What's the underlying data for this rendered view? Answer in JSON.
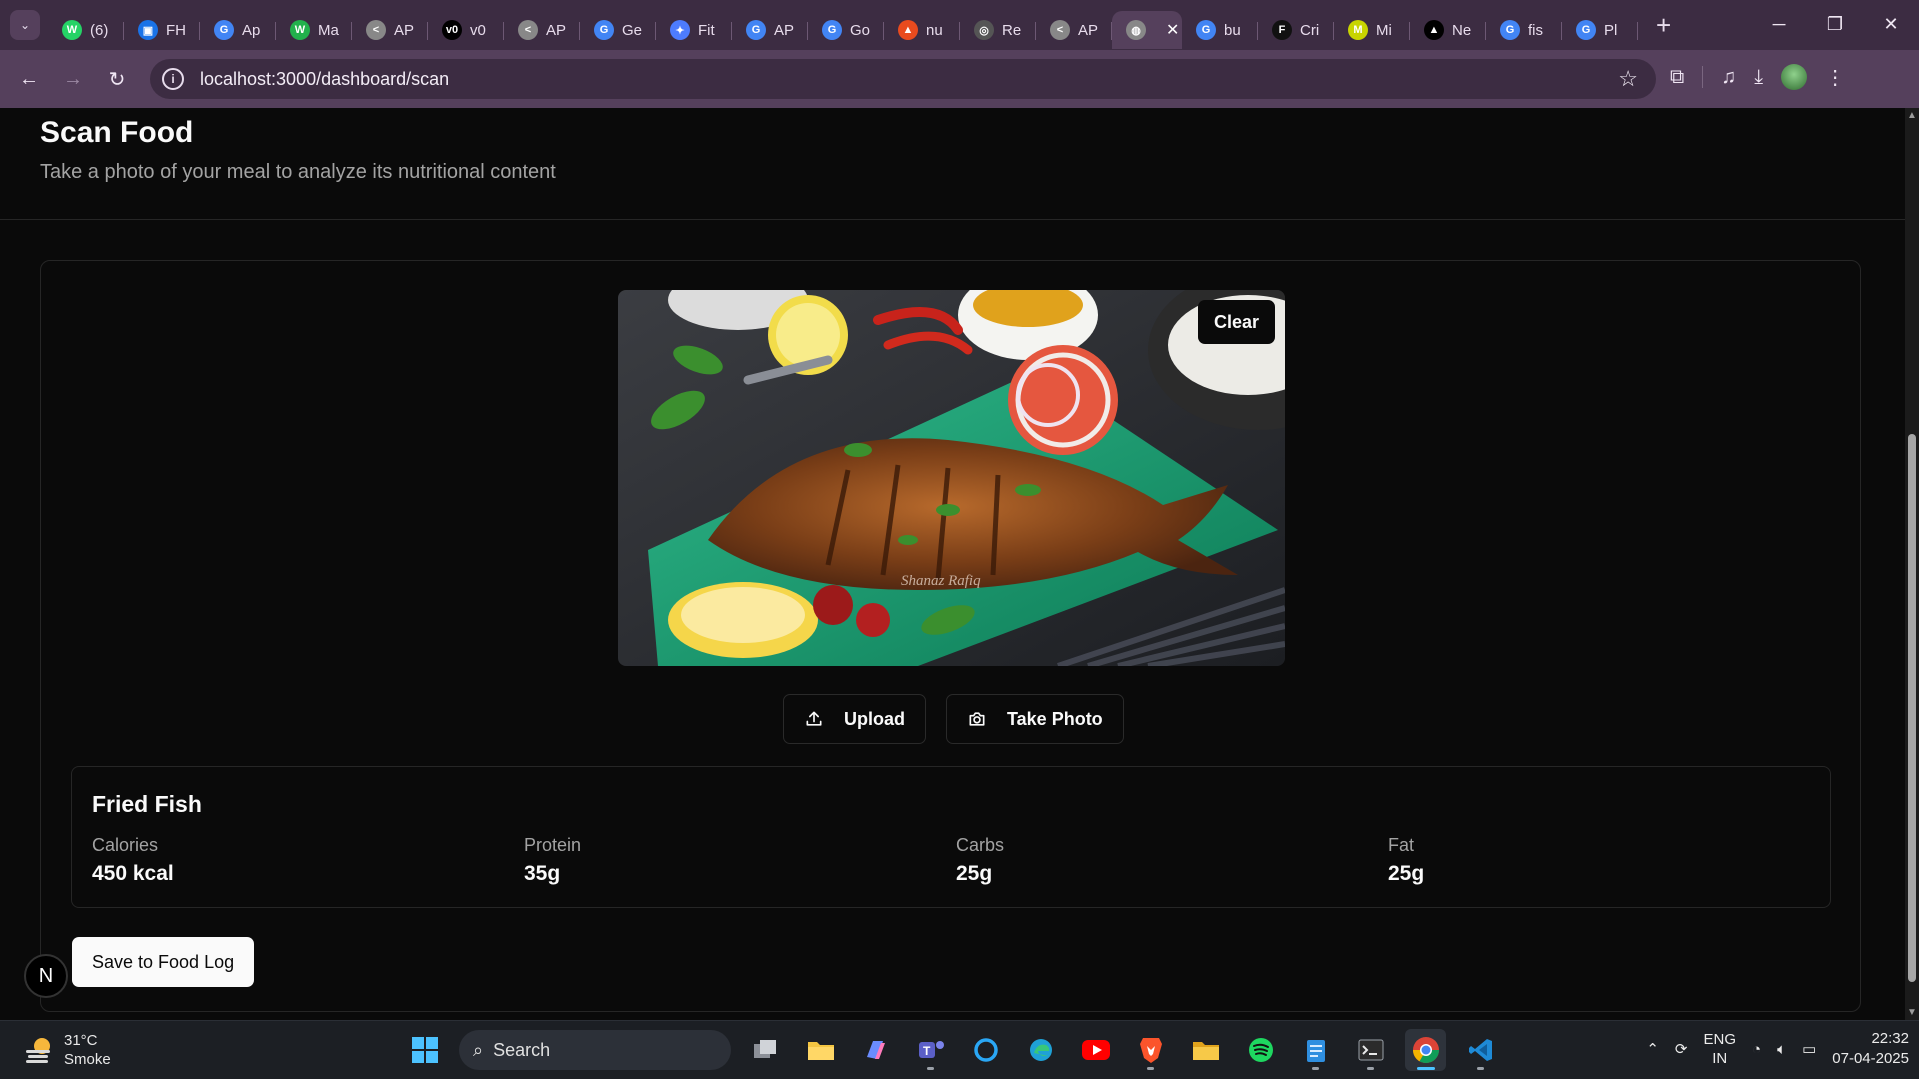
{
  "browser": {
    "tabs": [
      {
        "label": "(6)",
        "fav": "whatsapp-icon",
        "color": "#25d366",
        "glyph": "W"
      },
      {
        "label": "FH",
        "fav": "contact-icon",
        "color": "#1a73e8",
        "glyph": "▣"
      },
      {
        "label": "Ap",
        "fav": "google-icon",
        "color": "#4285f4",
        "glyph": "G"
      },
      {
        "label": "Ma",
        "fav": "w-icon",
        "color": "#22b14c",
        "glyph": "W"
      },
      {
        "label": "AP",
        "fav": "postman-icon",
        "color": "#888888",
        "glyph": "<"
      },
      {
        "label": "v0",
        "fav": "v0-icon",
        "color": "#000000",
        "glyph": "v0"
      },
      {
        "label": "AP",
        "fav": "postman-icon",
        "color": "#888888",
        "glyph": "<"
      },
      {
        "label": "Ge",
        "fav": "google-icon",
        "color": "#4285f4",
        "glyph": "G"
      },
      {
        "label": "Fit",
        "fav": "fit-icon",
        "color": "#4d7cfe",
        "glyph": "✦"
      },
      {
        "label": "AP",
        "fav": "google-icon",
        "color": "#4285f4",
        "glyph": "G"
      },
      {
        "label": "Go",
        "fav": "google-icon",
        "color": "#4285f4",
        "glyph": "G"
      },
      {
        "label": "nu",
        "fav": "flame-icon",
        "color": "#e94b1e",
        "glyph": "▲"
      },
      {
        "label": "Re",
        "fav": "openai-icon",
        "color": "#555555",
        "glyph": "◎"
      },
      {
        "label": "AP",
        "fav": "postman-icon",
        "color": "#888888",
        "glyph": "<"
      },
      {
        "label": "",
        "fav": "globe-icon",
        "color": "#888888",
        "glyph": "◍",
        "active": true
      },
      {
        "label": "bu",
        "fav": "google-icon",
        "color": "#4285f4",
        "glyph": "G"
      },
      {
        "label": "Cri",
        "fav": "fw-icon",
        "color": "#111111",
        "glyph": "F"
      },
      {
        "label": "Mi",
        "fav": "mi-icon",
        "color": "#c8d400",
        "glyph": "M"
      },
      {
        "label": "Ne",
        "fav": "vercel-icon",
        "color": "#000000",
        "glyph": "▲"
      },
      {
        "label": "fis",
        "fav": "google-icon",
        "color": "#4285f4",
        "glyph": "G"
      },
      {
        "label": "Pl",
        "fav": "google-icon",
        "color": "#4285f4",
        "glyph": "G"
      }
    ],
    "url": "localhost:3000/dashboard/scan"
  },
  "page": {
    "title": "Scan Food",
    "subtitle": "Take a photo of your meal to analyze its nutritional content",
    "clear_label": "Clear",
    "upload_label": "Upload",
    "take_photo_label": "Take Photo",
    "save_label": "Save to Food Log",
    "watermark": "Shanaz Rafiq",
    "result": {
      "food": "Fried Fish",
      "nutrients": [
        {
          "label": "Calories",
          "value": "450 kcal"
        },
        {
          "label": "Protein",
          "value": "35g"
        },
        {
          "label": "Carbs",
          "value": "25g"
        },
        {
          "label": "Fat",
          "value": "25g"
        }
      ]
    },
    "next_badge": "N"
  },
  "taskbar": {
    "temperature": "31°C",
    "condition": "Smoke",
    "search_label": "Search",
    "lang_top": "ENG",
    "lang_bottom": "IN",
    "time": "22:32",
    "date": "07-04-2025"
  }
}
